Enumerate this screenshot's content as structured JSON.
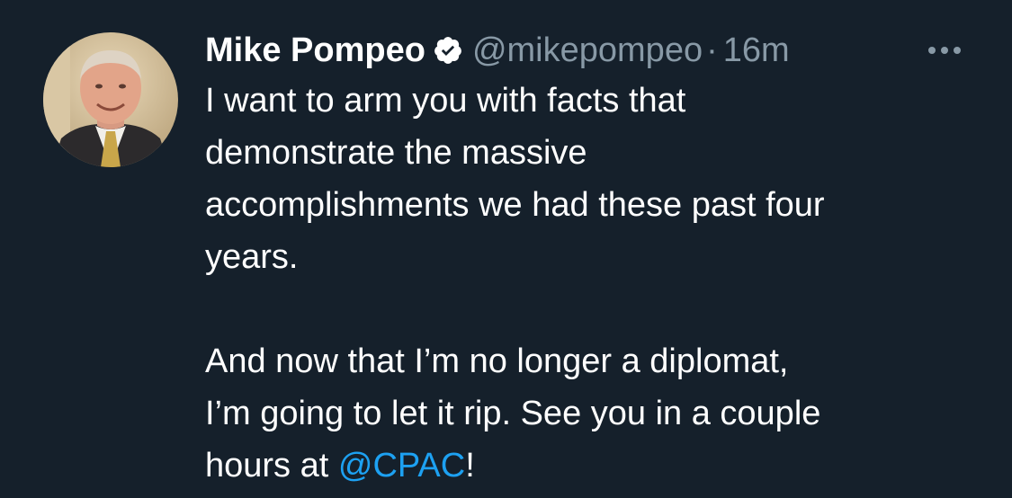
{
  "tweet": {
    "author_name": "Mike Pompeo",
    "handle": "@mikepompeo",
    "separator": "·",
    "time": "16m",
    "paragraph1_lines": [
      "I want to arm you with facts that",
      "demonstrate the massive",
      "accomplishments we had these past four",
      "years."
    ],
    "paragraph2_lines": [
      "And now that I’m no longer a diplomat,",
      "I’m going to let it rip. See you in a couple"
    ],
    "last_line_prefix": "hours at ",
    "mention": "@CPAC",
    "last_line_suffix": "!"
  },
  "icons": {
    "verified": "verified-badge-icon",
    "more": "more-options-icon"
  },
  "colors": {
    "background": "#15202b",
    "text": "#ffffff",
    "secondary": "#8899a6",
    "link": "#1da1f2"
  }
}
